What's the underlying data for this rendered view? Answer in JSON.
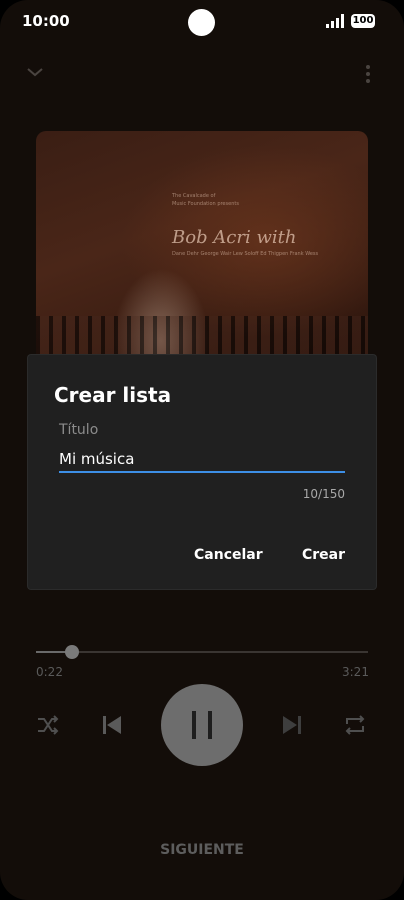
{
  "status_bar": {
    "time": "10:00",
    "battery": "100"
  },
  "album": {
    "small_text_1": "The Cavalcade of",
    "small_text_2": "Music Foundation presents",
    "title": "Bob Acri with",
    "subtitle": "Dane Dehr George Wair Lew Soloff Ed Thigpen Frank Wess"
  },
  "dialog": {
    "title": "Crear lista",
    "field_label": "Título",
    "field_value": "Mi música",
    "counter": "10/150",
    "cancel_label": "Cancelar",
    "create_label": "Crear"
  },
  "player": {
    "elapsed": "0:22",
    "duration": "3:21",
    "progress": 0.1095,
    "up_next_label": "SIGUIENTE"
  },
  "icons": {
    "collapse": "chevron-down-icon",
    "menu": "more-vert-icon",
    "shuffle": "shuffle-icon",
    "previous": "skip-previous-icon",
    "pause": "pause-icon",
    "next": "skip-next-icon",
    "repeat": "repeat-icon"
  },
  "colors": {
    "accent": "#3d8fe6",
    "dialog_bg": "#202020",
    "background": "#130d09"
  }
}
